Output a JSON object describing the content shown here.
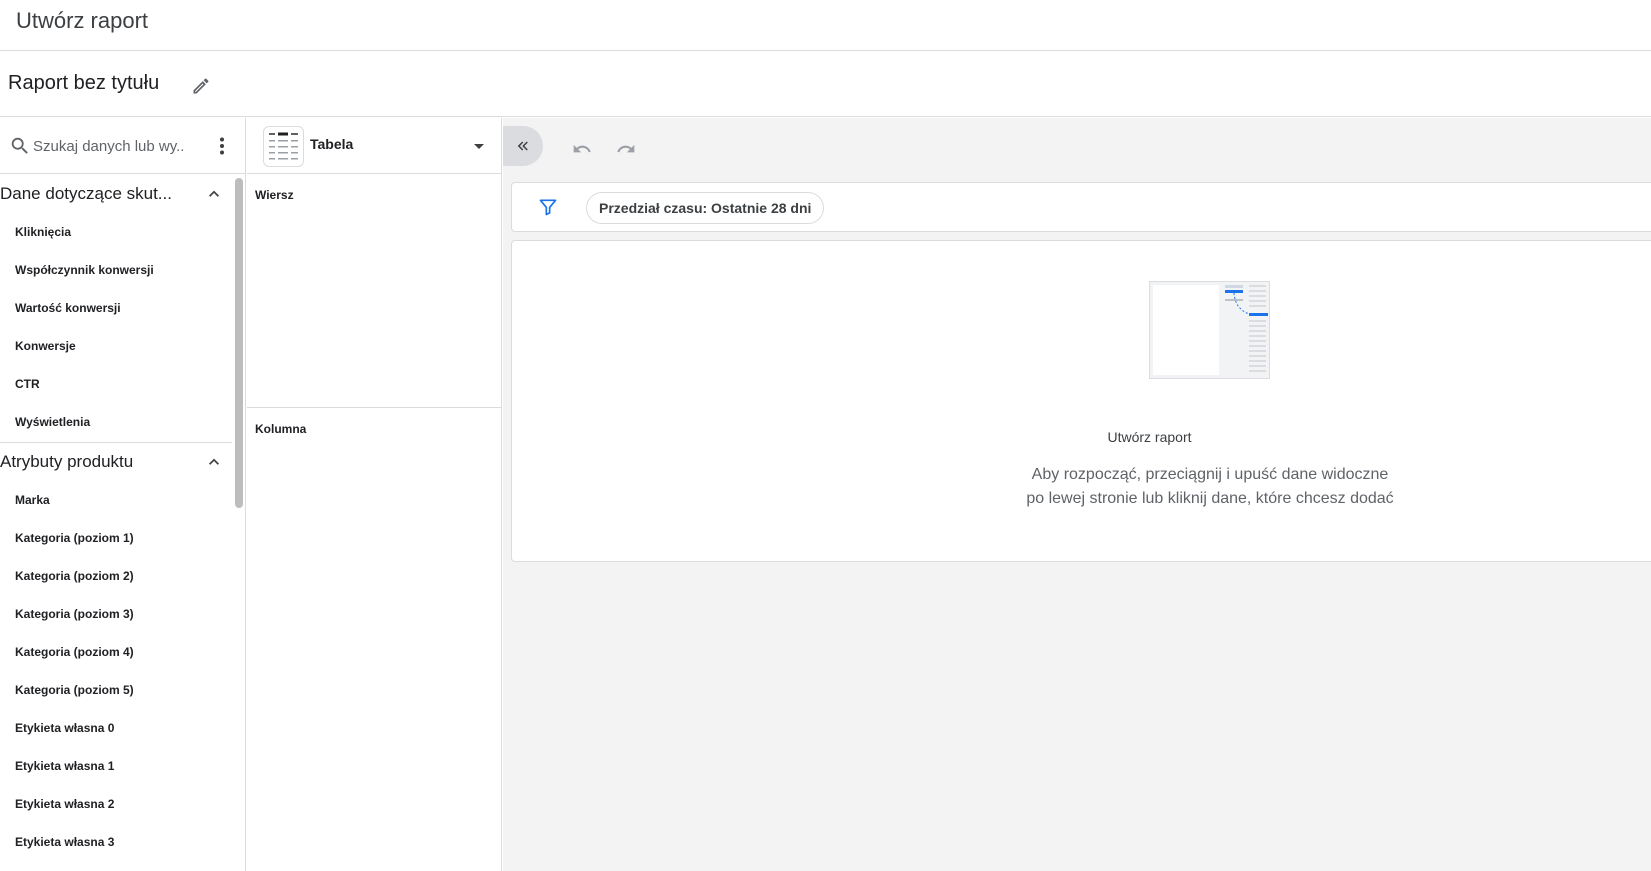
{
  "header": {
    "app_title": "Utwórz raport"
  },
  "report": {
    "title": "Raport bez tytułu"
  },
  "search": {
    "placeholder": "Szukaj danych lub wy..."
  },
  "field_groups": [
    {
      "title": "Dane dotyczące skut...",
      "expanded": true,
      "items": [
        "Kliknięcia",
        "Współczynnik konwersji",
        "Wartość konwersji",
        "Konwersje",
        "CTR",
        "Wyświetlenia"
      ]
    },
    {
      "title": "Atrybuty produktu",
      "expanded": true,
      "items": [
        "Marka",
        "Kategoria (poziom 1)",
        "Kategoria (poziom 2)",
        "Kategoria (poziom 3)",
        "Kategoria (poziom 4)",
        "Kategoria (poziom 5)",
        "Etykieta własna 0",
        "Etykieta własna 1",
        "Etykieta własna 2",
        "Etykieta własna 3"
      ]
    }
  ],
  "visualization": {
    "selected": "Tabela",
    "row_zone_label": "Wiersz",
    "column_zone_label": "Kolumna"
  },
  "filter": {
    "date_range_chip": "Przedział czasu: Ostatnie 28 dni"
  },
  "empty_state": {
    "title": "Utwórz raport",
    "text": "Aby rozpocząć, przeciągnij i upuść dane widoczne po lewej stronie lub kliknij dane, które chcesz dodać"
  },
  "colors": {
    "accent": "#1a73e8",
    "border": "#dadce0",
    "canvas_bg": "#f3f3f3",
    "icon_gray": "#5f6368"
  },
  "icons": {
    "edit": "pencil-icon",
    "search": "search-icon",
    "more": "more-vert-icon",
    "collapse": "double-chevron-left-icon",
    "undo": "undo-icon",
    "redo": "redo-icon",
    "filter": "filter-icon"
  }
}
